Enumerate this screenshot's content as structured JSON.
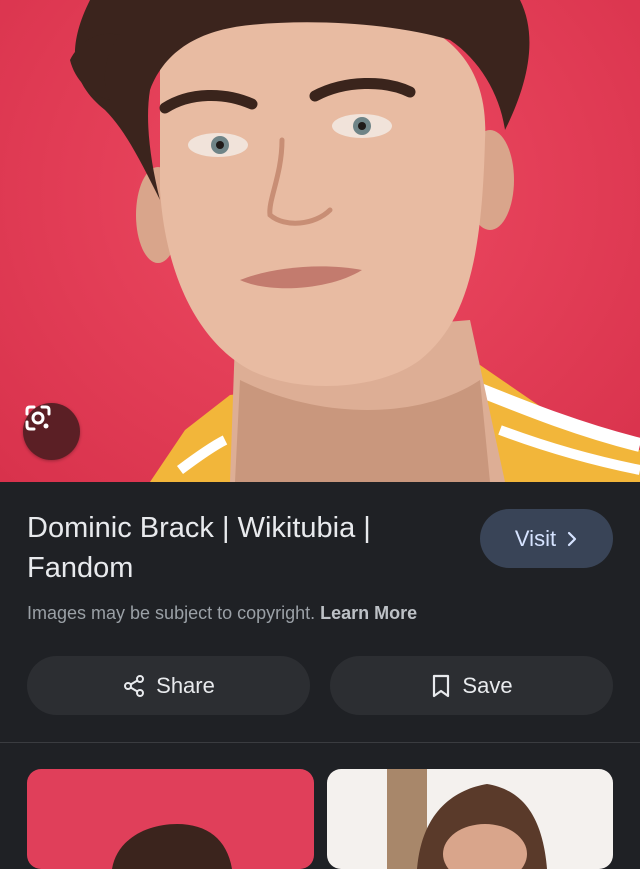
{
  "result": {
    "title": "Dominic Brack | Wikitubia | Fandom",
    "visit_label": "Visit",
    "copyright_text": "Images may be subject to copyright.",
    "learn_more": "Learn More",
    "share_label": "Share",
    "save_label": "Save"
  },
  "icons": {
    "lens": "google-lens-icon",
    "visit_arrow": "chevron-right-icon",
    "share": "share-icon",
    "save": "bookmark-icon"
  },
  "colors": {
    "background": "#1f2125",
    "hero_red": "#e23d56",
    "visit_button": "#394457",
    "action_button": "#2c2e32"
  }
}
